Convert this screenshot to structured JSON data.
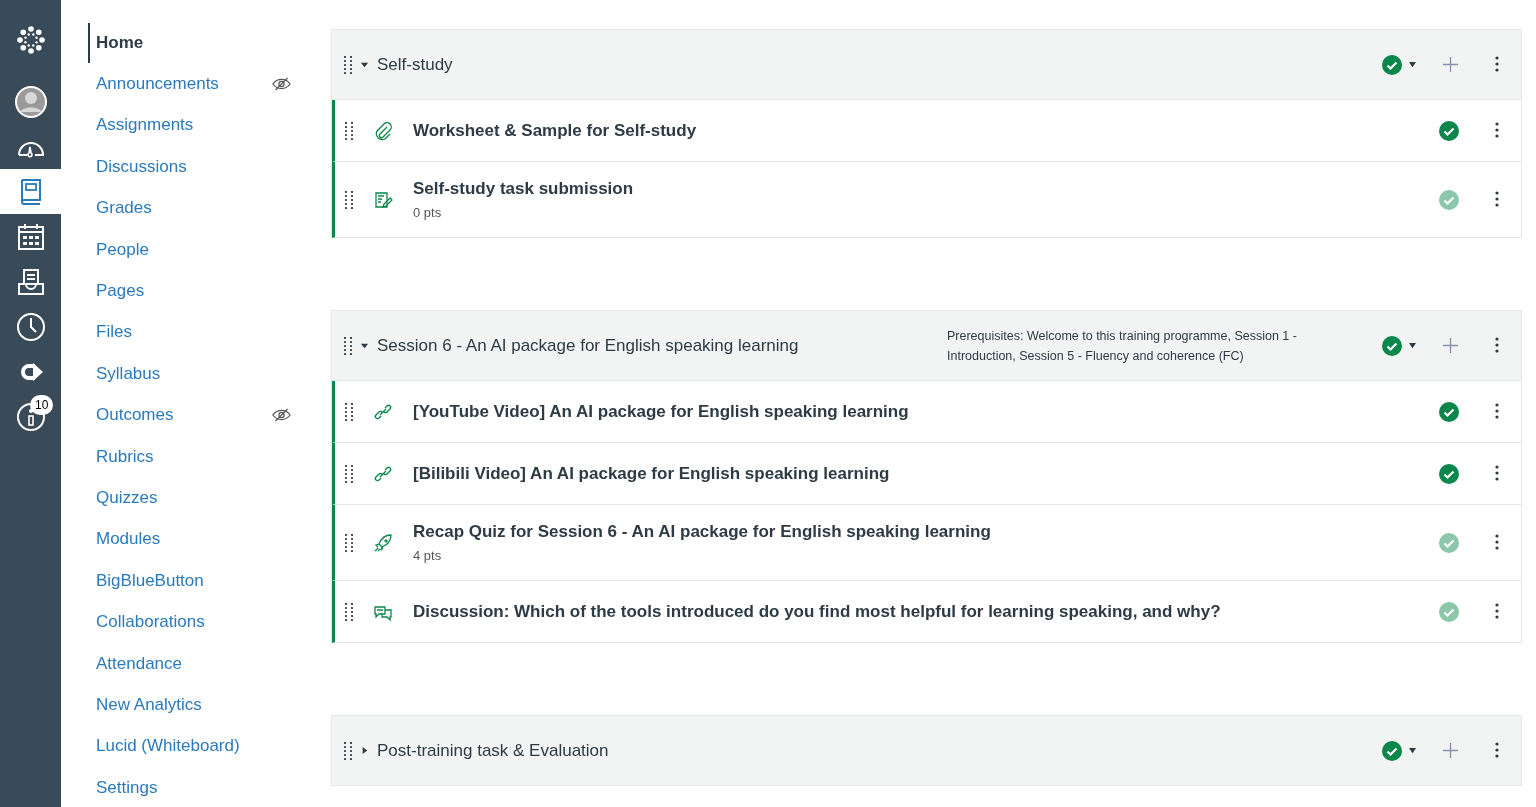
{
  "global_nav": [
    {
      "kind": "logo",
      "selected": false
    },
    {
      "kind": "account",
      "selected": false
    },
    {
      "kind": "dashboard",
      "selected": false
    },
    {
      "kind": "courses",
      "selected": true
    },
    {
      "kind": "calendar",
      "selected": false
    },
    {
      "kind": "inbox",
      "selected": false
    },
    {
      "kind": "history",
      "selected": false
    },
    {
      "kind": "commons",
      "selected": false
    },
    {
      "kind": "help",
      "selected": false,
      "badge": "10"
    }
  ],
  "course_nav": [
    {
      "label": "Home",
      "selected": true,
      "hidden": false
    },
    {
      "label": "Announcements",
      "selected": false,
      "hidden": true
    },
    {
      "label": "Assignments",
      "selected": false,
      "hidden": false
    },
    {
      "label": "Discussions",
      "selected": false,
      "hidden": false
    },
    {
      "label": "Grades",
      "selected": false,
      "hidden": false
    },
    {
      "label": "People",
      "selected": false,
      "hidden": false
    },
    {
      "label": "Pages",
      "selected": false,
      "hidden": false
    },
    {
      "label": "Files",
      "selected": false,
      "hidden": false
    },
    {
      "label": "Syllabus",
      "selected": false,
      "hidden": false
    },
    {
      "label": "Outcomes",
      "selected": false,
      "hidden": true
    },
    {
      "label": "Rubrics",
      "selected": false,
      "hidden": false
    },
    {
      "label": "Quizzes",
      "selected": false,
      "hidden": false
    },
    {
      "label": "Modules",
      "selected": false,
      "hidden": false
    },
    {
      "label": "BigBlueButton",
      "selected": false,
      "hidden": false
    },
    {
      "label": "Collaborations",
      "selected": false,
      "hidden": false
    },
    {
      "label": "Attendance",
      "selected": false,
      "hidden": false
    },
    {
      "label": "New Analytics",
      "selected": false,
      "hidden": false
    },
    {
      "label": "Lucid (Whiteboard)",
      "selected": false,
      "hidden": false
    },
    {
      "label": "Settings",
      "selected": false,
      "hidden": false
    }
  ],
  "modules": [
    {
      "title": "Self-study",
      "expanded": true,
      "published": true,
      "items": [
        {
          "kind": "attachment",
          "title": "Worksheet & Sample for Self-study",
          "published": true
        },
        {
          "kind": "assignment",
          "title": "Self-study task submission",
          "points": "0 pts",
          "published": false
        }
      ]
    },
    {
      "title": "Session 6 - An AI package for English speaking learning",
      "expanded": true,
      "published": true,
      "prerequisites": "Prerequisites: Welcome to this training programme, Session 1 - Introduction, Session 5 - Fluency and coherence (FC)",
      "items": [
        {
          "kind": "link",
          "title": "[YouTube Video] An AI package for English speaking learning",
          "published": true
        },
        {
          "kind": "link",
          "title": "[Bilibili Video] An AI package for English speaking learning",
          "published": true
        },
        {
          "kind": "quiz",
          "title": "Recap Quiz for Session 6 - An AI package for English speaking learning",
          "points": "4 pts",
          "published": false
        },
        {
          "kind": "discussion",
          "title": "Discussion: Which of the tools introduced do you find most helpful for learning speaking, and why?",
          "published": false
        }
      ]
    },
    {
      "title": "Post-training task & Evaluation",
      "expanded": false,
      "published": true
    }
  ]
}
